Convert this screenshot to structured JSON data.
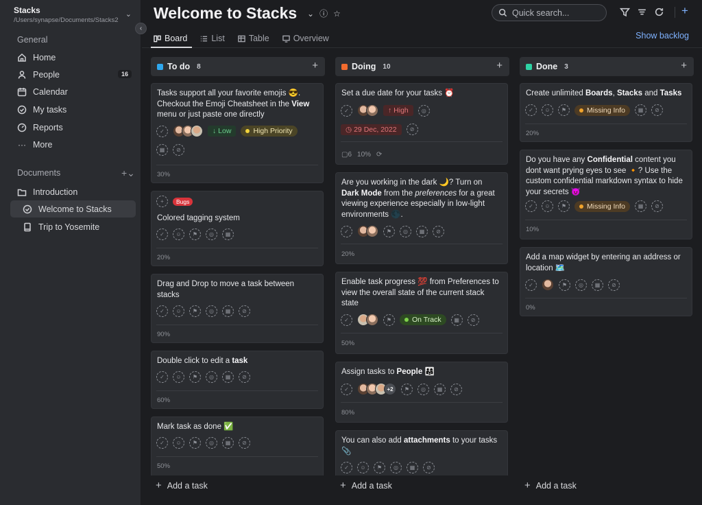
{
  "sidebar": {
    "workspace_name": "Stacks",
    "workspace_path": "/Users/synapse/Documents/Stacks2",
    "general_title": "General",
    "items": [
      {
        "label": "Home"
      },
      {
        "label": "People",
        "badge": "16"
      },
      {
        "label": "Calendar"
      },
      {
        "label": "My tasks"
      },
      {
        "label": "Reports"
      },
      {
        "label": "More"
      }
    ],
    "documents_title": "Documents",
    "documents": [
      {
        "label": "Introduction"
      },
      {
        "label": "Welcome to Stacks"
      },
      {
        "label": "Trip to Yosemite"
      }
    ]
  },
  "header": {
    "title": "Welcome to Stacks",
    "search_placeholder": "Quick search...",
    "tabs": [
      {
        "label": "Board"
      },
      {
        "label": "List"
      },
      {
        "label": "Table"
      },
      {
        "label": "Overview"
      }
    ],
    "show_backlog": "Show backlog"
  },
  "columns": [
    {
      "name": "To do",
      "count": "8",
      "color": "#2ea7ee",
      "add_label": "Add a task",
      "cards": [
        {
          "parts": [
            "Tasks support all your favorite emojis 😎. Checkout the Emoji Cheatsheet in the ",
            "View",
            " menu or just paste one directly"
          ],
          "low": "↓ Low",
          "priority": "High Priority",
          "pct": "30%"
        },
        {
          "bugs": "Bugs",
          "text": "Colored tagging system",
          "pct": "20%"
        },
        {
          "text": "Drag and Drop to move a task between stacks",
          "pct": "90%"
        },
        {
          "parts": [
            "Double click to edit a ",
            "task"
          ],
          "pct": "60%"
        },
        {
          "text": "Mark task as done ✅",
          "pct": "50%"
        }
      ]
    },
    {
      "name": "Doing",
      "count": "10",
      "color": "#f26b2e",
      "add_label": "Add a task",
      "cards": [
        {
          "text": "Set a due date for your tasks ⏰",
          "high": "↑ High",
          "date": "29 Dec, 2022",
          "comments": "6",
          "pct": "10%"
        },
        {
          "parts": [
            "Are you working in the dark 🌙? Turn on ",
            "Dark Mode",
            " from the ",
            "preferences",
            " for a great viewing experience especially in low-light environments 🌑."
          ],
          "pct": "20%"
        },
        {
          "text": "Enable task progress 💯 from Preferences to view the overall state of the current stack state",
          "track": "On Track",
          "pct": "50%"
        },
        {
          "parts": [
            "Assign tasks to ",
            "People",
            " 👨‍👩‍👧"
          ],
          "more": "+2",
          "pct": "80%"
        },
        {
          "parts": [
            "You can also add ",
            "attachments",
            " to your tasks 📎"
          ]
        }
      ]
    },
    {
      "name": "Done",
      "count": "3",
      "color": "#2ed3a4",
      "add_label": "Add a task",
      "cards": [
        {
          "parts": [
            "Create unlimited ",
            "Boards",
            ", ",
            "Stacks",
            " and ",
            "Tasks"
          ],
          "missing": "Missing Info",
          "pct": "20%"
        },
        {
          "parts": [
            "Do you have any ",
            "Confidential",
            " content you dont want prying eyes to see 🔸? Use the custom confidential markdown syntax to hide your secrets 😈"
          ],
          "missing": "Missing Info",
          "pct": "10%"
        },
        {
          "text": "Add a map widget by entering an address or location 🗺️",
          "pct": "0%"
        }
      ]
    }
  ]
}
